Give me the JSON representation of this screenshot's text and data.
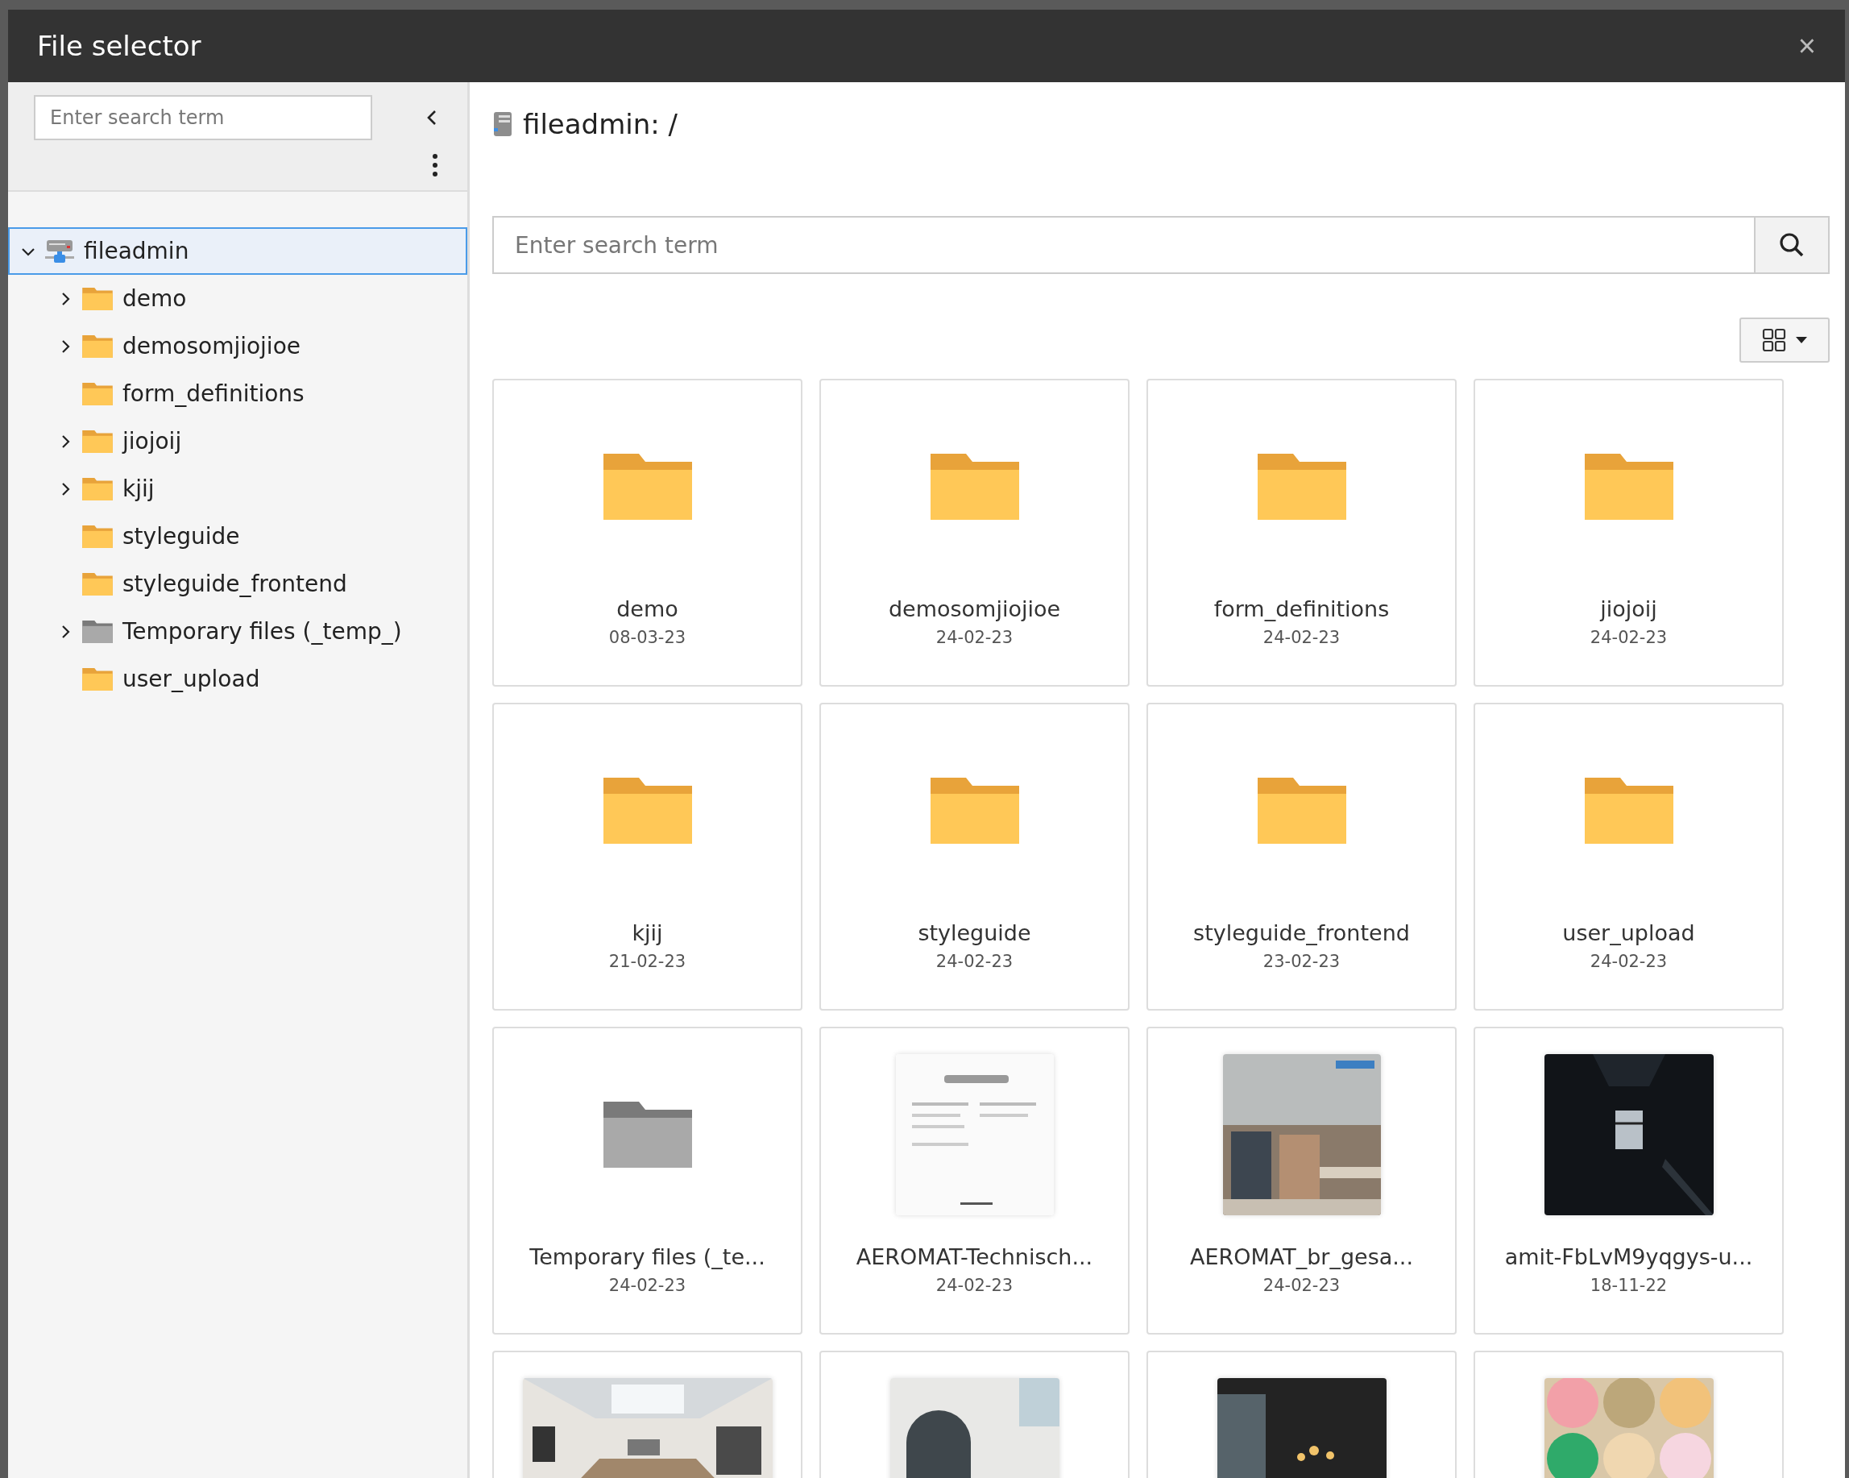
{
  "window": {
    "title": "File selector",
    "close": "×"
  },
  "sidebar": {
    "search": {
      "placeholder": "Enter search term"
    },
    "tree": [
      {
        "label": "fileadmin",
        "kind": "storage",
        "expandable": true,
        "expanded": true,
        "selected": true,
        "children": [
          {
            "label": "demo",
            "kind": "folder",
            "expandable": true,
            "expanded": false,
            "selected": false
          },
          {
            "label": "demosomjiojioe",
            "kind": "folder",
            "expandable": true,
            "expanded": false,
            "selected": false
          },
          {
            "label": "form_definitions",
            "kind": "folder",
            "expandable": false,
            "expanded": false,
            "selected": false
          },
          {
            "label": "jiojoij",
            "kind": "folder",
            "expandable": true,
            "expanded": false,
            "selected": false
          },
          {
            "label": "kjij",
            "kind": "folder",
            "expandable": true,
            "expanded": false,
            "selected": false
          },
          {
            "label": "styleguide",
            "kind": "folder",
            "expandable": false,
            "expanded": false,
            "selected": false
          },
          {
            "label": "styleguide_frontend",
            "kind": "folder",
            "expandable": false,
            "expanded": false,
            "selected": false
          },
          {
            "label": "Temporary files (_temp_)",
            "kind": "temp",
            "expandable": true,
            "expanded": false,
            "selected": false
          },
          {
            "label": "user_upload",
            "kind": "folder",
            "expandable": false,
            "expanded": false,
            "selected": false
          }
        ]
      }
    ]
  },
  "main": {
    "path": "fileadmin: /",
    "search": {
      "placeholder": "Enter search term"
    },
    "items": [
      {
        "kind": "folder",
        "name": "demo",
        "date": "08-03-23"
      },
      {
        "kind": "folder",
        "name": "demosomjiojioe",
        "date": "24-02-23"
      },
      {
        "kind": "folder",
        "name": "form_definitions",
        "date": "24-02-23"
      },
      {
        "kind": "folder",
        "name": "jiojoij",
        "date": "24-02-23"
      },
      {
        "kind": "folder",
        "name": "kjij",
        "date": "21-02-23"
      },
      {
        "kind": "folder",
        "name": "styleguide",
        "date": "24-02-23"
      },
      {
        "kind": "folder",
        "name": "styleguide_frontend",
        "date": "23-02-23"
      },
      {
        "kind": "folder",
        "name": "user_upload",
        "date": "24-02-23"
      },
      {
        "kind": "temp",
        "name": "Temporary files (_te...",
        "date": "24-02-23"
      },
      {
        "kind": "picture",
        "name": "AEROMAT-Technisch...",
        "date": "24-02-23"
      },
      {
        "kind": "picture",
        "name": "AEROMAT_br_gesa...",
        "date": "24-02-23"
      },
      {
        "kind": "picture",
        "name": "amit-FbLvM9yqgys-u...",
        "date": "18-11-22"
      },
      {
        "kind": "picture"
      },
      {
        "kind": "picture"
      },
      {
        "kind": "picture"
      },
      {
        "kind": "picture"
      }
    ]
  }
}
